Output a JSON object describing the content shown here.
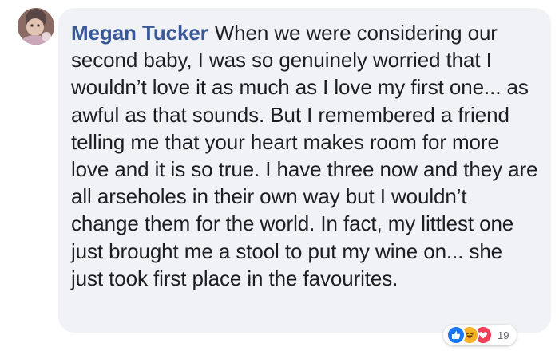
{
  "comment": {
    "author": "Megan Tucker",
    "text": "When we were considering our second baby, I was so genuinely worried that I wouldn’t love it as much as I love my first one... as awful as that sounds. But I remembered a friend telling me that your heart makes room for more love and it is so true. I have three now and they are all arseholes in their own way but I wouldn’t change them for the world. In fact, my littlest one just brought me a stool to put my wine on... she just took first place in the favourites."
  },
  "reactions": {
    "count": "19",
    "icons": [
      "like-icon",
      "haha-icon",
      "love-icon"
    ]
  },
  "colors": {
    "bubble": "#f0f2f5",
    "author": "#385898",
    "text": "#1c1e21",
    "like": "#1877f2",
    "haha": "#f7b125",
    "love": "#f33e58"
  }
}
